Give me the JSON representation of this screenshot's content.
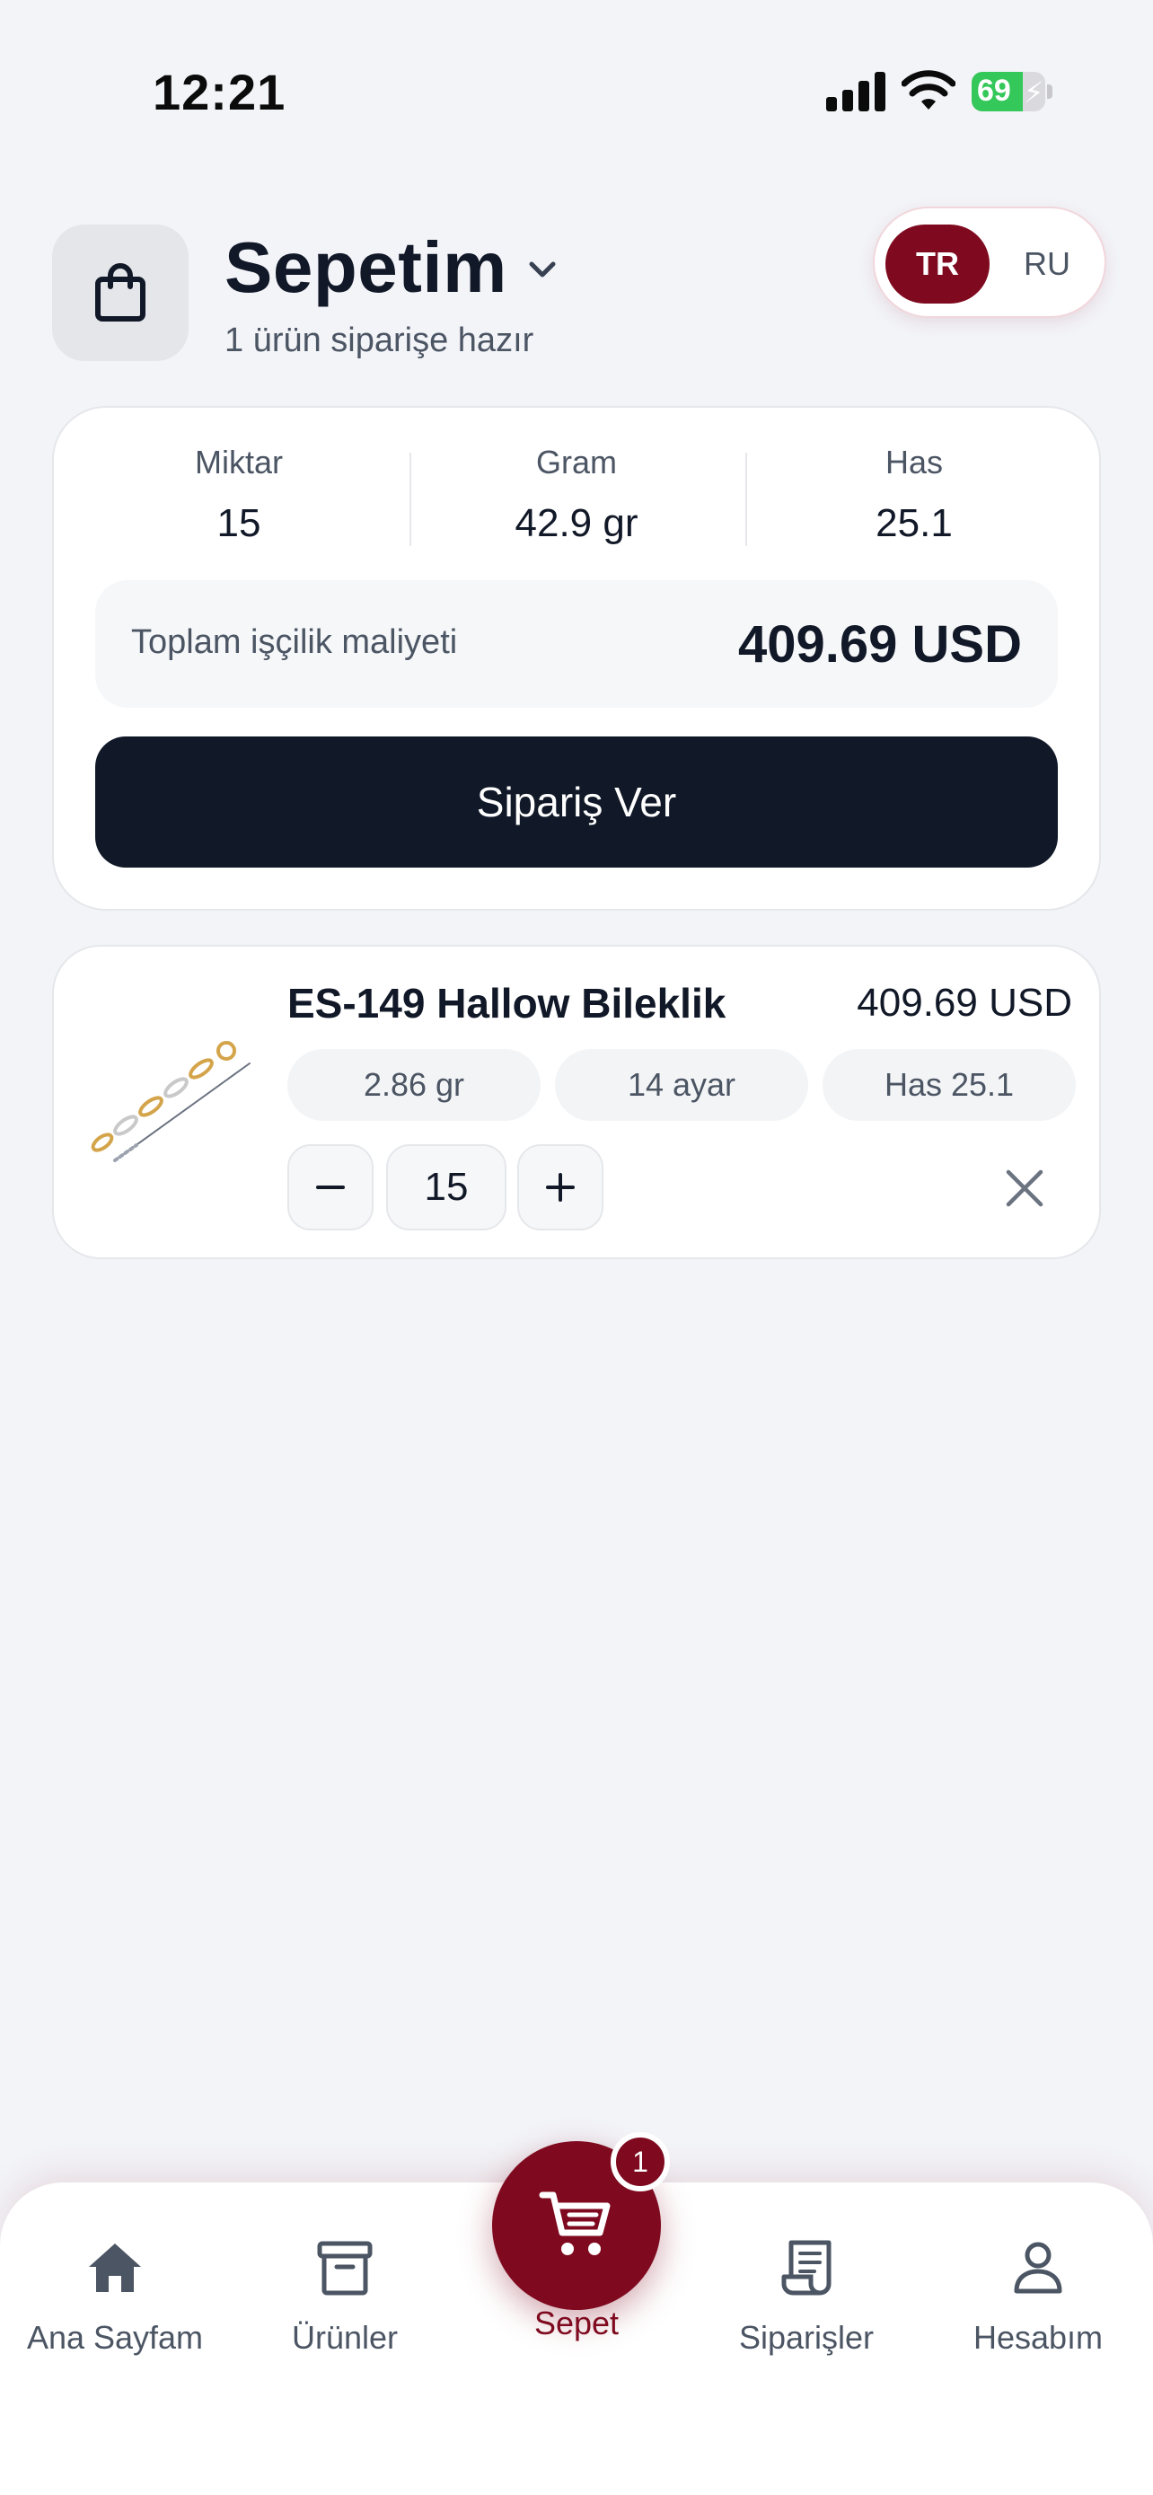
{
  "status_bar": {
    "time": "12:21",
    "battery_percent": "69",
    "battery_level": 0.69
  },
  "header": {
    "title": "Sepetim",
    "subtitle": "1 ürün siparişe hazır",
    "languages": [
      {
        "label": "TR",
        "active": true
      },
      {
        "label": "RU",
        "active": false
      }
    ]
  },
  "summary": {
    "stats": [
      {
        "label": "Miktar",
        "value": "15"
      },
      {
        "label": "Gram",
        "value": "42.9 gr"
      },
      {
        "label": "Has",
        "value": "25.1"
      }
    ],
    "labor_label": "Toplam işçilik maliyeti",
    "labor_value": "409.69 USD",
    "order_button": "Sipariş Ver"
  },
  "cart_items": [
    {
      "title": "ES-149 Hallow Bileklik",
      "price": "409.69 USD",
      "chips": [
        "2.86 gr",
        "14 ayar",
        "Has 25.1"
      ],
      "quantity": "15"
    }
  ],
  "nav": {
    "items": [
      {
        "label": "Ana Sayfam",
        "icon": "home-icon"
      },
      {
        "label": "Ürünler",
        "icon": "archive-box-icon"
      },
      {
        "label": "Sepet",
        "icon": "cart-icon",
        "badge": "1",
        "active": true
      },
      {
        "label": "Siparişler",
        "icon": "receipt-icon"
      },
      {
        "label": "Hesabım",
        "icon": "user-icon"
      }
    ]
  },
  "colors": {
    "accent": "#7f0a1f",
    "dark": "#111827",
    "background": "#f3f4f8",
    "muted_text": "#4b5563"
  }
}
